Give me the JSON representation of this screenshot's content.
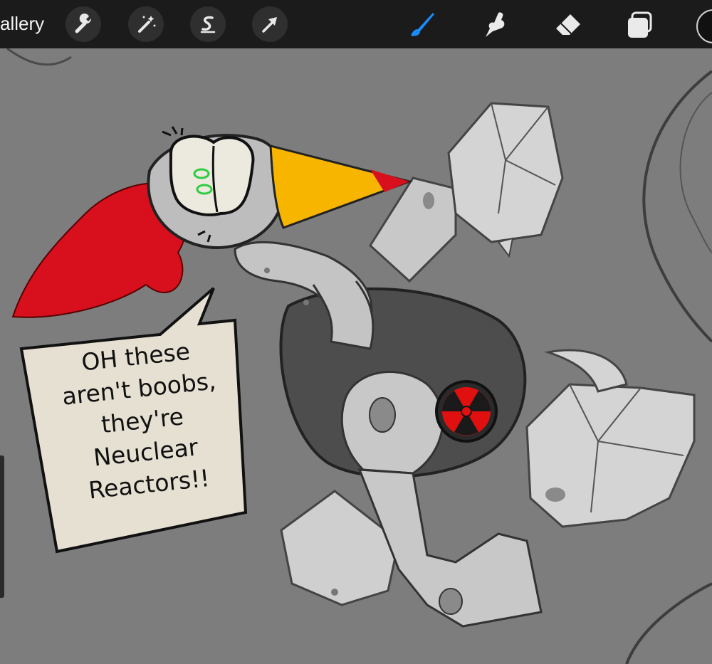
{
  "toolbar": {
    "gallery_label": "allery",
    "left_tools": [
      {
        "icon": "wrench-icon",
        "label": "Actions"
      },
      {
        "icon": "magic-wand-icon",
        "label": "Adjustments"
      },
      {
        "icon": "selection-icon",
        "label": "Selection"
      },
      {
        "icon": "transform-arrow-icon",
        "label": "Transform"
      }
    ],
    "right_tools": [
      {
        "icon": "brush-icon",
        "active": true
      },
      {
        "icon": "smudge-icon",
        "active": false
      },
      {
        "icon": "eraser-icon",
        "active": false
      },
      {
        "icon": "layers-icon",
        "active": false
      }
    ],
    "accent_color": "#1a8cff"
  },
  "speech_bubble": {
    "lines": [
      "OH these",
      "aren't boobs,",
      "they're",
      "Neuclear",
      "Reactors!!"
    ]
  },
  "colors": {
    "background": "#7d7d7d",
    "toolbar": "#1b1b1b",
    "comb": "#d8101e",
    "beak": "#f7b500",
    "robot_gray": "#bfbfbf",
    "body_dark": "#4a4a4a",
    "eye_green": "#2ecc40",
    "reactor_red": "#e01010"
  }
}
